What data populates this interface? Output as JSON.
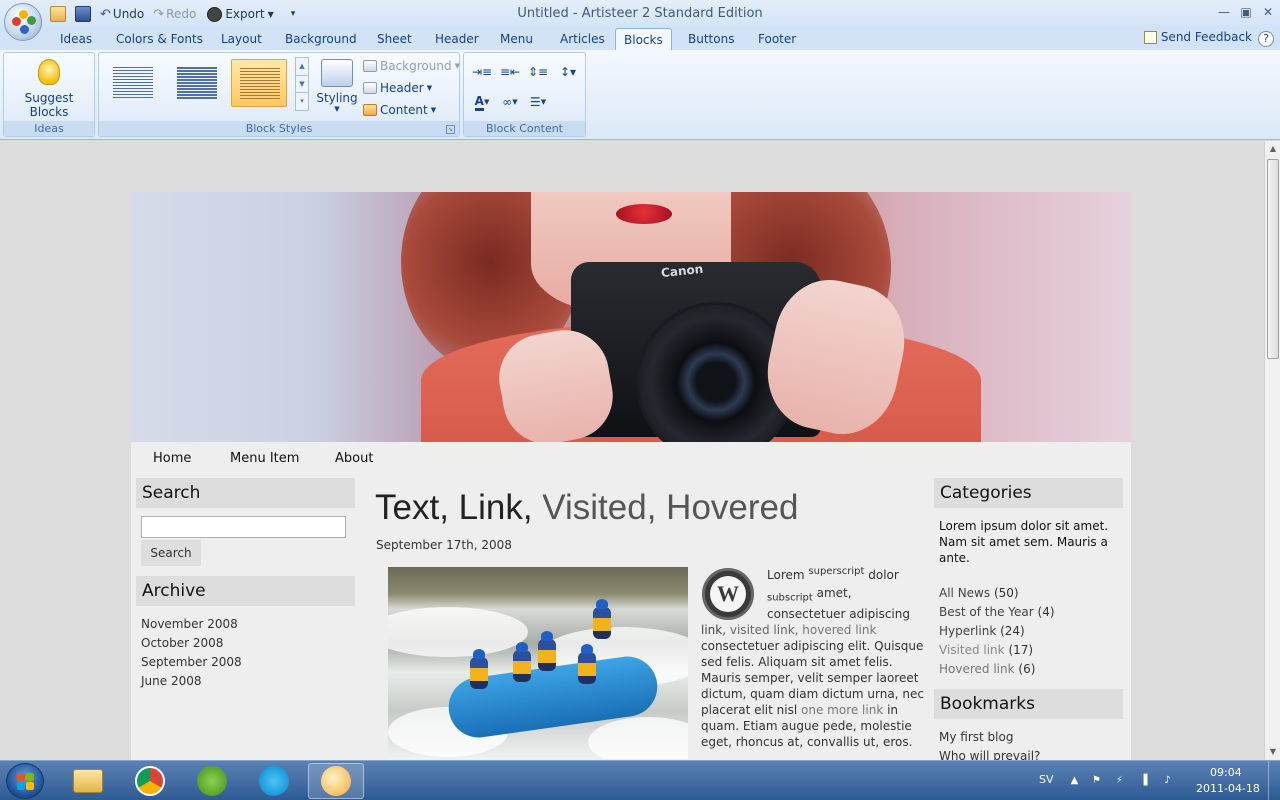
{
  "app": {
    "title": "Untitled - Artisteer 2 Standard Edition",
    "quick_access": {
      "undo": "Undo",
      "redo": "Redo",
      "export": "Export"
    },
    "window_controls": {
      "minimize": "—",
      "restore": "▣",
      "close": "✕"
    }
  },
  "ribbon": {
    "tabs": [
      "Ideas",
      "Colors & Fonts",
      "Layout",
      "Background",
      "Sheet",
      "Header",
      "Menu",
      "Articles",
      "Blocks",
      "Buttons",
      "Footer"
    ],
    "active_tab": "Blocks",
    "send_feedback": "Send Feedback",
    "help": "?",
    "groups": {
      "ideas": {
        "label": "Ideas",
        "suggest_blocks": "Suggest Blocks"
      },
      "block_styles": {
        "label": "Block Styles",
        "styling": "Styling",
        "background": "Background",
        "header": "Header",
        "content": "Content"
      },
      "block_content": {
        "label": "Block Content"
      }
    }
  },
  "page": {
    "nav": [
      "Home",
      "Menu Item",
      "About"
    ],
    "left_sidebar": {
      "search_title": "Search",
      "search_button": "Search",
      "search_value": "",
      "archive_title": "Archive",
      "archive": [
        "November 2008",
        "October 2008",
        "September 2008",
        "June 2008"
      ]
    },
    "post": {
      "title_part1": "Text, Link, ",
      "title_visited": "Visited, ",
      "title_hovered": "Hovered",
      "date": "September 17th, 2008",
      "image_brand": "Canon",
      "wp_letter": "W",
      "lorem": "Lorem",
      "superscript": "superscript",
      "dolor": "dolor",
      "subscript": "subscript",
      "amet": "amet,",
      "line3": "consectetuer adipiscing",
      "link": "link,",
      "visited_link": "visited link,",
      "hovered_link": "hovered link",
      "line5": "consectetuer adipiscing elit. Quisque",
      "line6": "sed felis. Aliquam sit amet felis.",
      "line7": "Mauris semper, velit semper laoreet",
      "line8": "dictum, quam diam dictum urna, nec",
      "line9a": "placerat elit nisl ",
      "one_more_link": "one more link",
      "line9b": " in",
      "line10": "quam. Etiam augue pede, molestie",
      "line11": "eget, rhoncus at, convallis ut, eros."
    },
    "right_sidebar": {
      "categories_title": "Categories",
      "categories_text": [
        "Lorem ipsum dolor sit amet.",
        "Nam sit amet sem. Mauris a",
        "ante."
      ],
      "categories": [
        {
          "name": "All News",
          "count": "(50)"
        },
        {
          "name": "Best of the Year",
          "count": "(4)"
        },
        {
          "name": "Hyperlink",
          "count": "(24)"
        },
        {
          "name": "Visited link",
          "count": "(17)"
        },
        {
          "name": "Hovered link",
          "count": "(6)"
        }
      ],
      "bookmarks_title": "Bookmarks",
      "bookmarks": [
        "My first blog",
        "Who will prevail?"
      ]
    }
  },
  "taskbar": {
    "language": "SV",
    "time": "09:04",
    "date": "2011-04-18",
    "tray_arrow": "▲"
  }
}
